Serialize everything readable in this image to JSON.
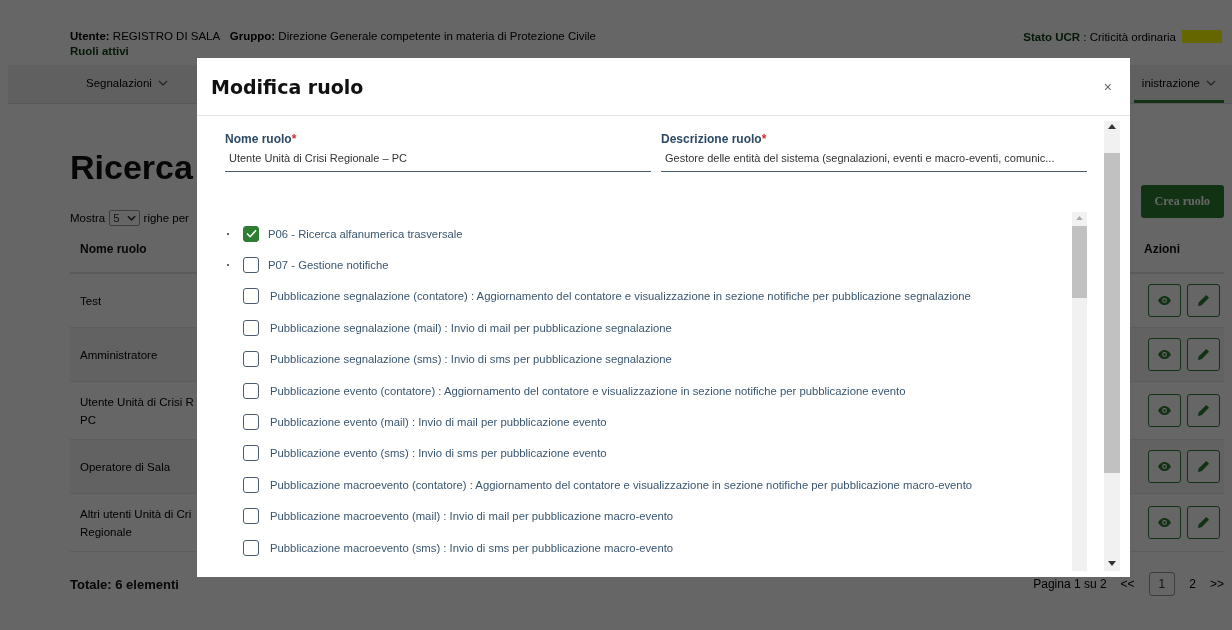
{
  "header": {
    "user_label": "Utente:",
    "user": "REGISTRO DI SALA",
    "group_label": "Gruppo:",
    "group": "Direzione Generale competente in materia di Protezione Civile",
    "roles_link": "Ruoli attivi",
    "status_label": "Stato UCR",
    "status": ": Criticità ordinaria"
  },
  "nav": [
    {
      "label": "Segnalazioni",
      "selected": false
    },
    {
      "label": "inistrazione",
      "selected": true
    }
  ],
  "page": {
    "title": "Ricerca",
    "show_label": "Mostra",
    "page_size": "5",
    "per_page_label": "righe per",
    "create_button": "Crea ruolo"
  },
  "table": {
    "columns": [
      "Nome ruolo",
      "Azioni"
    ],
    "rows": [
      {
        "name_lines": [
          "Test"
        ]
      },
      {
        "name_lines": [
          "Amministratore"
        ]
      },
      {
        "name_lines": [
          "Utente Unità di Crisi R",
          "PC"
        ]
      },
      {
        "name_lines": [
          "Operatore di Sala"
        ]
      },
      {
        "name_lines": [
          "Altri utenti Unità di Cri",
          "Regionale"
        ]
      }
    ]
  },
  "footer": {
    "total": "Totale: 6 elementi",
    "page_info": "Pagina 1 su 2",
    "first": "<<",
    "pages": [
      {
        "label": "1",
        "selected": true
      },
      {
        "label": "2",
        "selected": false
      }
    ],
    "last": ">>"
  },
  "modal": {
    "title": "Modifica ruolo",
    "close": "×",
    "fields": [
      {
        "label": "Nome ruolo",
        "required_mark": "*",
        "value": "Utente Unità di Crisi Regionale – PC"
      },
      {
        "label": "Descrizione ruolo",
        "required_mark": "*",
        "value": "Gestore delle entità del sistema (segnalazioni, eventi e macro-eventi, comunic..."
      }
    ],
    "permissions": [
      {
        "label": "P06 - Ricerca alfanumerica trasversale",
        "checked": true
      },
      {
        "label": "P07 - Gestione notifiche",
        "checked": false,
        "children": [
          {
            "label": "Pubblicazione segnalazione (contatore) : Aggiornamento del contatore e visualizzazione in sezione notifiche per pubblicazione segnalazione",
            "checked": false
          },
          {
            "label": "Pubblicazione segnalazione (mail) : Invio di mail per pubblicazione segnalazione",
            "checked": false
          },
          {
            "label": "Pubblicazione segnalazione (sms) : Invio di sms per pubblicazione segnalazione",
            "checked": false
          },
          {
            "label": "Pubblicazione evento (contatore) : Aggiornamento del contatore e visualizzazione in sezione notifiche per pubblicazione evento",
            "checked": false
          },
          {
            "label": "Pubblicazione evento (mail) : Invio di mail per pubblicazione evento",
            "checked": false
          },
          {
            "label": "Pubblicazione evento (sms) : Invio di sms per pubblicazione evento",
            "checked": false
          },
          {
            "label": "Pubblicazione macroevento (contatore) : Aggiornamento del contatore e visualizzazione in sezione notifiche per pubblicazione macro-evento",
            "checked": false
          },
          {
            "label": "Pubblicazione macroevento (mail) : Invio di mail per pubblicazione macro-evento",
            "checked": false
          },
          {
            "label": "Pubblicazione macroevento (sms) : Invio di sms per pubblicazione macro-evento",
            "checked": false
          }
        ]
      }
    ]
  }
}
